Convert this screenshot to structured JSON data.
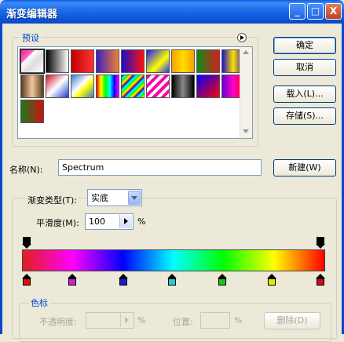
{
  "window": {
    "title": "渐变编辑器",
    "minimize": "_",
    "maximize": "□",
    "close": "X"
  },
  "presets": {
    "label": "预设",
    "menu_icon": "play-arrow-icon",
    "swatches": [
      "linear-gradient(135deg,#ff1a8c 0%,#ff66cc 30%,#fff 31%,#ddd 60%,#fff 100%)",
      "linear-gradient(to right,#000,#fff)",
      "linear-gradient(to right,#c00000,#ff3333)",
      "linear-gradient(to right,#3a1fbf,#f08030)",
      "linear-gradient(to right,#1a0fc8,#ff1010)",
      "linear-gradient(135deg,#1818ff,#ffff00 60%,#3030ff)",
      "linear-gradient(to right,#f6a000,#ffdd00,#f6a000)",
      "linear-gradient(to right,#0a8c1a,#d81c1c)",
      "linear-gradient(to right,#1a0fc8,#ffe000,#1a0fc8)",
      "linear-gradient(to right,#5b3a1f,#f0c8a0,#5b3a1f)",
      "linear-gradient(135deg,#d0102a,#fff 50%,#1a3cd0)",
      "linear-gradient(135deg,#3b7ad6,#fff 45%,#ff0 60%,#3b7ad6)",
      "linear-gradient(to right,#ff0000,#ffff00,#00ff00,#00ffff,#0000ff,#ff00ff)",
      "repeating-linear-gradient(135deg,#00c,#0ff 8%,#0f0 14%,#ff0 20%,#f00 26%)",
      "repeating-linear-gradient(135deg,#ff00aa 0 4px,#ffffff 4px 8px)",
      "linear-gradient(to right,#000,#888,#000)",
      "linear-gradient(135deg,#0000ff,#ff0000)",
      "linear-gradient(to right,#6600cc,#ff00cc,#ff0000)",
      "linear-gradient(to right,#1a7a1a,#d01010)"
    ]
  },
  "buttons": {
    "ok": "确定",
    "cancel": "取消",
    "load": "载入(L)...",
    "save": "存储(S)...",
    "new": "新建(W)"
  },
  "name": {
    "label": "名称(N):",
    "value": "Spectrum"
  },
  "gradient_type": {
    "label": "渐变类型(T):",
    "value": "实底"
  },
  "smoothness": {
    "label": "平滑度(M):",
    "value": "100",
    "unit": "%"
  },
  "gradient": {
    "colors": [
      "#e0201b",
      "#ff00ff",
      "#0000ff",
      "#00ffff",
      "#00ff00",
      "#ffff00",
      "#ff0000"
    ],
    "color_stops": [
      {
        "pos": 0,
        "color": "#dd1010"
      },
      {
        "pos": 15.5,
        "color": "#d020d0"
      },
      {
        "pos": 33,
        "color": "#1020d0"
      },
      {
        "pos": 49.5,
        "color": "#20d0d0"
      },
      {
        "pos": 66.5,
        "color": "#20c020"
      },
      {
        "pos": 83.5,
        "color": "#e8e800"
      },
      {
        "pos": 100,
        "color": "#cc1010"
      }
    ],
    "opacity_stops": [
      0,
      100
    ]
  },
  "stops": {
    "label": "色标",
    "opacity_label": "不透明度:",
    "location_label": "位置:",
    "delete": "删除(D)",
    "percent": "%"
  }
}
